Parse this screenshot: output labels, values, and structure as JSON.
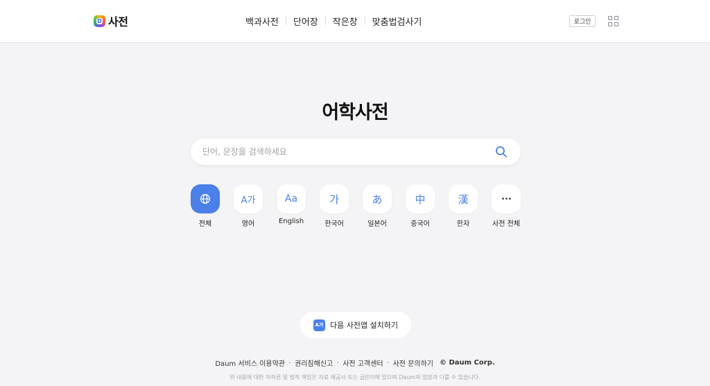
{
  "header": {
    "logo_text": "사전",
    "logo_mark": "D",
    "nav": [
      "백과사전",
      "단어장",
      "작은창",
      "맞춤법검사기"
    ],
    "login_label": "로그인",
    "apps_icon": "grid-icon"
  },
  "main": {
    "title": "어학사전",
    "search": {
      "placeholder": "단어, 문장을 검색하세요",
      "value": "",
      "icon": "search-icon"
    },
    "categories": [
      {
        "glyph": "",
        "label": "전체",
        "active": true,
        "icon": "globe-icon"
      },
      {
        "glyph": "A가",
        "label": "영어",
        "active": false,
        "icon": "english-korean-icon"
      },
      {
        "glyph": "Aa",
        "label": "English",
        "active": false,
        "icon": "english-icon"
      },
      {
        "glyph": "가",
        "label": "한국어",
        "active": false,
        "icon": "korean-icon"
      },
      {
        "glyph": "あ",
        "label": "일본어",
        "active": false,
        "icon": "japanese-icon"
      },
      {
        "glyph": "中",
        "label": "중국어",
        "active": false,
        "icon": "chinese-icon"
      },
      {
        "glyph": "漢",
        "label": "한자",
        "active": false,
        "icon": "hanja-icon"
      },
      {
        "glyph": "•••",
        "label": "사전 전체",
        "active": false,
        "icon": "more-icon"
      }
    ]
  },
  "app_install": {
    "icon_text": "A가",
    "label": "다음 사전앱 설치하기"
  },
  "footer": {
    "links": [
      "Daum 서비스 이용약관",
      "권리침해신고",
      "사전 고객센터",
      "사전 문의하기"
    ],
    "copyright": "© Daum Corp.",
    "note": "위 내용에 대한 저작권 및 법적 책임은 자료 제공사 또는 글쓴이에 있으며 Daum의 입장과 다를 수 있습니다."
  },
  "colors": {
    "accent": "#4a80e8",
    "background": "#f4f4f6"
  }
}
